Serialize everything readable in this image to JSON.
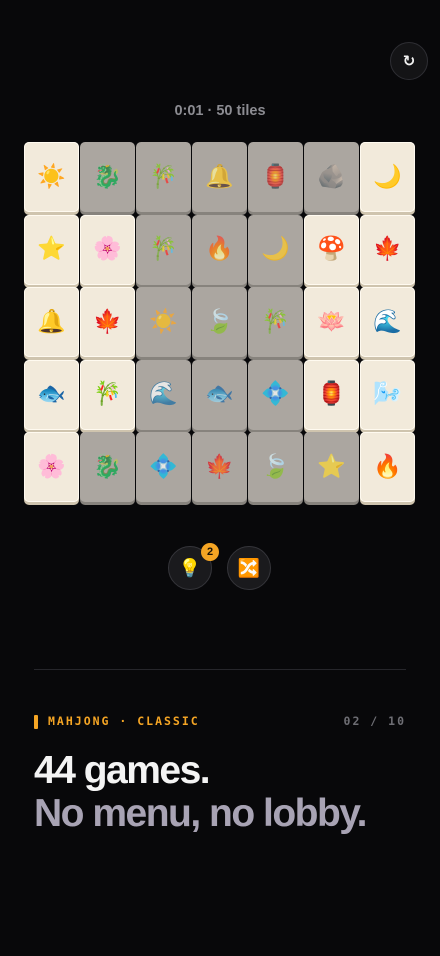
{
  "header": {
    "restart_icon": "↻",
    "status": "0:01 · 50 tiles"
  },
  "board": {
    "columns": 7,
    "rows": 5,
    "tiles": [
      {
        "symbol": "☀️",
        "name": "sun",
        "free": true
      },
      {
        "symbol": "🐉",
        "name": "dragon",
        "free": false
      },
      {
        "symbol": "🎋",
        "name": "bamboo",
        "free": false
      },
      {
        "symbol": "🔔",
        "name": "bell",
        "free": false
      },
      {
        "symbol": "🏮",
        "name": "lantern",
        "free": false
      },
      {
        "symbol": "🪨",
        "name": "stone",
        "free": false
      },
      {
        "symbol": "🌙",
        "name": "moon",
        "free": true
      },
      {
        "symbol": "⭐",
        "name": "star",
        "free": true
      },
      {
        "symbol": "🌸",
        "name": "blossom",
        "free": true
      },
      {
        "symbol": "🎋",
        "name": "bamboo",
        "free": false
      },
      {
        "symbol": "🔥",
        "name": "fire",
        "free": false
      },
      {
        "symbol": "🌙",
        "name": "moon",
        "free": false
      },
      {
        "symbol": "🍄",
        "name": "mushroom",
        "free": true
      },
      {
        "symbol": "🍁",
        "name": "maple-leaf",
        "free": true
      },
      {
        "symbol": "🔔",
        "name": "bell",
        "free": true
      },
      {
        "symbol": "🍁",
        "name": "maple-leaf",
        "free": true
      },
      {
        "symbol": "☀️",
        "name": "sun",
        "free": false
      },
      {
        "symbol": "🍃",
        "name": "leaf",
        "free": false
      },
      {
        "symbol": "🎋",
        "name": "bamboo",
        "free": false
      },
      {
        "symbol": "🪷",
        "name": "lotus",
        "free": true
      },
      {
        "symbol": "🌊",
        "name": "wave",
        "free": true
      },
      {
        "symbol": "🐟",
        "name": "fish",
        "free": true
      },
      {
        "symbol": "🎋",
        "name": "bamboo",
        "free": true
      },
      {
        "symbol": "🌊",
        "name": "wave",
        "free": false
      },
      {
        "symbol": "🐟",
        "name": "fish",
        "free": false
      },
      {
        "symbol": "💠",
        "name": "diamond",
        "free": false
      },
      {
        "symbol": "🏮",
        "name": "lantern",
        "free": true
      },
      {
        "symbol": "🌬️",
        "name": "wind",
        "free": true
      },
      {
        "symbol": "🌸",
        "name": "blossom",
        "free": true
      },
      {
        "symbol": "🐉",
        "name": "dragon",
        "free": false
      },
      {
        "symbol": "💠",
        "name": "diamond",
        "free": false
      },
      {
        "symbol": "🍁",
        "name": "maple-leaf",
        "free": false
      },
      {
        "symbol": "🍃",
        "name": "leaf",
        "free": false
      },
      {
        "symbol": "⭐",
        "name": "star",
        "free": false
      },
      {
        "symbol": "🔥",
        "name": "fire",
        "free": true
      }
    ]
  },
  "tools": {
    "hint_icon": "💡",
    "hint_count": "2",
    "shuffle_icon": "🔀"
  },
  "footer": {
    "kicker": "MAHJONG · CLASSIC",
    "counter": "02 / 10",
    "headline": "44 games.",
    "subline": "No menu, no lobby."
  },
  "colors": {
    "background": "#08080a",
    "accent": "#f5a524",
    "tile_free": "#f2eadb",
    "tile_blocked": "#aba6a0",
    "subline": "#a8a3b4"
  }
}
